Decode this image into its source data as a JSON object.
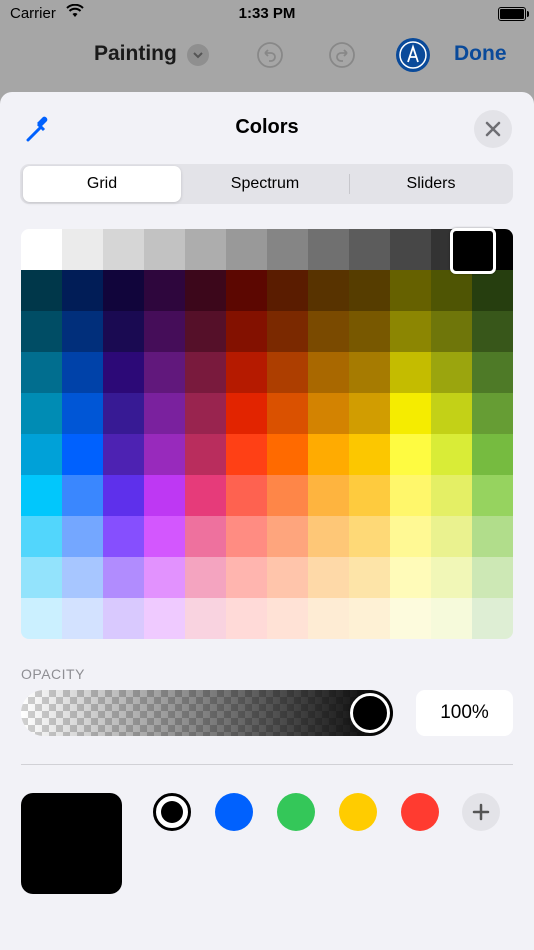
{
  "status_bar": {
    "carrier": "Carrier",
    "time": "1:33 PM"
  },
  "nav": {
    "title": "Painting",
    "done_label": "Done",
    "accent": "#0a4a9a"
  },
  "sheet": {
    "title": "Colors",
    "tabs": [
      {
        "label": "Grid",
        "selected": true
      },
      {
        "label": "Spectrum",
        "selected": false
      },
      {
        "label": "Sliders",
        "selected": false
      }
    ]
  },
  "grid": {
    "selected_color": "#000000",
    "rows": [
      [
        "#ffffff",
        "#ebebeb",
        "#d6d6d6",
        "#c2c2c2",
        "#adadad",
        "#999999",
        "#858585",
        "#707070",
        "#5c5c5c",
        "#474747",
        "#333333",
        "#000000"
      ],
      [
        "#00374a",
        "#011d57",
        "#11053b",
        "#2e063d",
        "#3c071b",
        "#5c0701",
        "#5a1c00",
        "#583300",
        "#563d00",
        "#666100",
        "#4f5504",
        "#263e0f"
      ],
      [
        "#004d65",
        "#012f7b",
        "#1a0a52",
        "#450d59",
        "#551029",
        "#831100",
        "#7b2900",
        "#7a4a00",
        "#785800",
        "#8c8602",
        "#6f760a",
        "#38571a"
      ],
      [
        "#016e8f",
        "#0042a9",
        "#2c0977",
        "#61187c",
        "#791a3d",
        "#b51a00",
        "#ad3e00",
        "#a96800",
        "#a67b01",
        "#c4bc00",
        "#9ba50e",
        "#4e7a27"
      ],
      [
        "#008cb4",
        "#0056d6",
        "#371a94",
        "#7a219e",
        "#99244f",
        "#e22400",
        "#da5100",
        "#d38301",
        "#d19d01",
        "#f5ec00",
        "#c3d117",
        "#669d34"
      ],
      [
        "#00a1d8",
        "#0061fe",
        "#4d22b2",
        "#982abc",
        "#b92d5d",
        "#ff4015",
        "#ff6a00",
        "#ffab01",
        "#fcc700",
        "#fefb41",
        "#d9ec37",
        "#76bb40"
      ],
      [
        "#01c7fc",
        "#3a87fe",
        "#5e30eb",
        "#be38f3",
        "#e63b7a",
        "#fe6250",
        "#fe8648",
        "#feb43f",
        "#fecb3e",
        "#fff76b",
        "#e4ef65",
        "#96d35f"
      ],
      [
        "#52d6fc",
        "#74a7ff",
        "#864ffe",
        "#d357fe",
        "#ee719e",
        "#ff8c82",
        "#fea57d",
        "#fec777",
        "#fed977",
        "#fff994",
        "#eaf28f",
        "#b1dd8b"
      ],
      [
        "#93e3fc",
        "#a7c6ff",
        "#b18cfe",
        "#e292fe",
        "#f4a4c0",
        "#ffb5af",
        "#ffc5ab",
        "#fed9a8",
        "#fde4a8",
        "#fffbb9",
        "#f1f7b7",
        "#cde8b5"
      ],
      [
        "#cbf0ff",
        "#d3e2ff",
        "#d9c9fe",
        "#efcaff",
        "#f9d3e0",
        "#ffdad8",
        "#ffe2d6",
        "#feecd4",
        "#fef1d5",
        "#fdfbdd",
        "#f6fadb",
        "#deeed4"
      ]
    ]
  },
  "opacity": {
    "label": "OPACITY",
    "value_text": "100%",
    "value": 100
  },
  "swatches": {
    "current_color": "#000000",
    "colors": [
      "#000000",
      "#0061fe",
      "#34c759",
      "#ffcc00",
      "#ff3b30"
    ]
  },
  "icons": [
    "wifi-icon",
    "battery-icon",
    "chevron-down-icon",
    "undo-icon",
    "redo-icon",
    "markup-pen-icon",
    "eyedropper-icon",
    "close-icon",
    "plus-icon"
  ]
}
